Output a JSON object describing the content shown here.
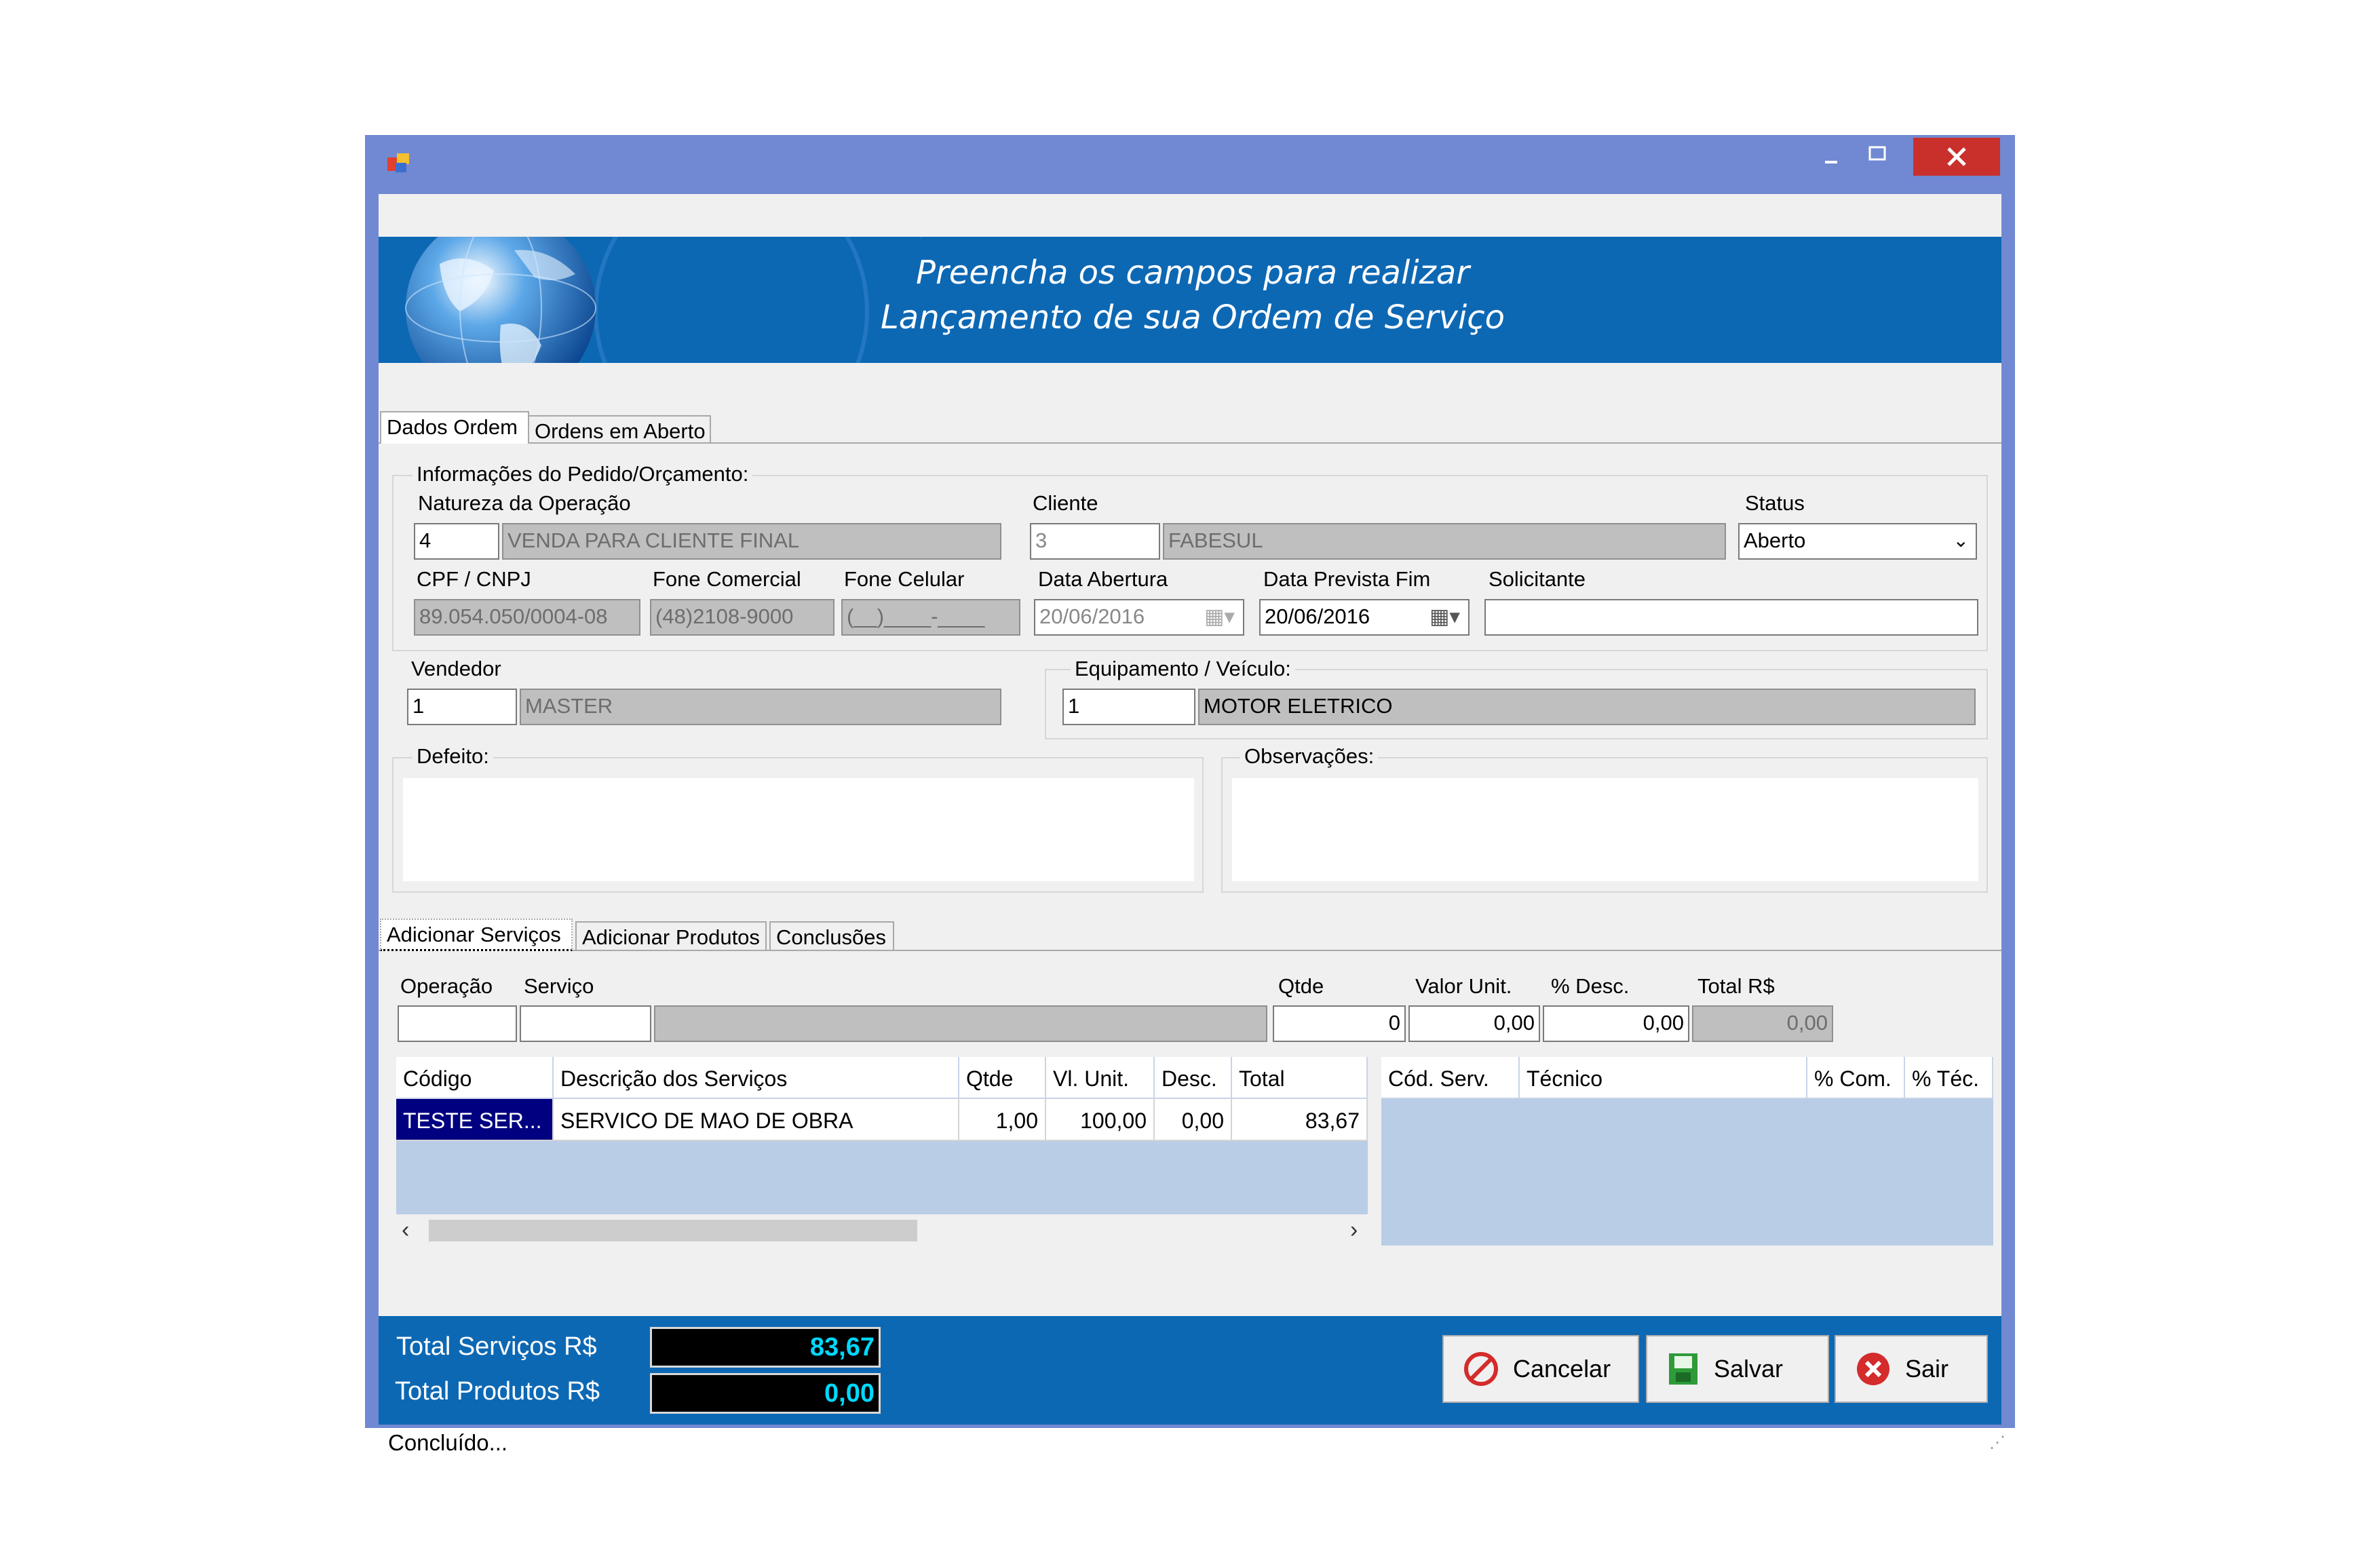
{
  "window": {
    "title_icon": "app-icon",
    "banner_line1": "Preencha os campos para realizar",
    "banner_line2": "Lançamento de sua Ordem de Serviço"
  },
  "tabs": [
    {
      "label": "Dados Ordem",
      "active": true
    },
    {
      "label": "Ordens em Aberto",
      "active": false
    }
  ],
  "pedido": {
    "group_label": "Informações do Pedido/Orçamento:",
    "natureza_label": "Natureza da Operação",
    "natureza_code": "4",
    "natureza_desc": "VENDA PARA CLIENTE FINAL",
    "cliente_label": "Cliente",
    "cliente_code": "3",
    "cliente_name": "FABESUL",
    "status_label": "Status",
    "status_value": "Aberto",
    "cpf_label": "CPF / CNPJ",
    "cpf_value": "89.054.050/0004-08",
    "fone_com_label": "Fone Comercial",
    "fone_com_value": "(48)2108-9000",
    "fone_cel_label": "Fone Celular",
    "fone_cel_value": "(__)____-____",
    "data_abertura_label": "Data Abertura",
    "data_abertura_value": "20/06/2016",
    "data_prev_label": "Data Prevista Fim",
    "data_prev_value": "20/06/2016",
    "solicitante_label": "Solicitante",
    "solicitante_value": ""
  },
  "vendedor": {
    "label": "Vendedor",
    "code": "1",
    "name": "MASTER"
  },
  "equipamento": {
    "label": "Equipamento / Veículo:",
    "code": "1",
    "name": "MOTOR ELETRICO"
  },
  "defeito": {
    "label": "Defeito:",
    "value": ""
  },
  "observacoes": {
    "label": "Observações:",
    "value": ""
  },
  "subtabs": [
    {
      "label": "Adicionar Serviços",
      "active": true
    },
    {
      "label": "Adicionar Produtos",
      "active": false
    },
    {
      "label": "Conclusões",
      "active": false
    }
  ],
  "servico_entry": {
    "operacao_label": "Operação",
    "operacao_value": "",
    "servico_label": "Serviço",
    "servico_value": "",
    "servico_desc": "",
    "qtde_label": "Qtde",
    "qtde_value": "0",
    "valor_label": "Valor Unit.",
    "valor_value": "0,00",
    "desc_label": "% Desc.",
    "desc_value": "0,00",
    "total_label": "Total R$",
    "total_value": "0,00"
  },
  "services_grid": {
    "headers": [
      "Código",
      "Descrição dos Serviços",
      "Qtde",
      "Vl. Unit.",
      "Desc.",
      "Total"
    ],
    "rows": [
      {
        "codigo": "TESTE SER...",
        "descricao": "SERVICO DE MAO DE OBRA",
        "qtde": "1,00",
        "vl_unit": "100,00",
        "desc": "0,00",
        "total": "83,67"
      }
    ]
  },
  "tech_grid": {
    "headers": [
      "Cód. Serv.",
      "Técnico",
      "% Com.",
      "% Téc."
    ]
  },
  "totals": {
    "servicos_label": "Total Serviços R$",
    "servicos_value": "83,67",
    "produtos_label": "Total Produtos R$",
    "produtos_value": "0,00"
  },
  "buttons": {
    "cancelar": "Cancelar",
    "salvar": "Salvar",
    "sair": "Sair"
  },
  "status_text": "Concluído...",
  "colors": {
    "window_frame": "#7189d2",
    "banner": "#0d68b4",
    "close_button": "#c9302c",
    "selected_cell": "#000080"
  }
}
